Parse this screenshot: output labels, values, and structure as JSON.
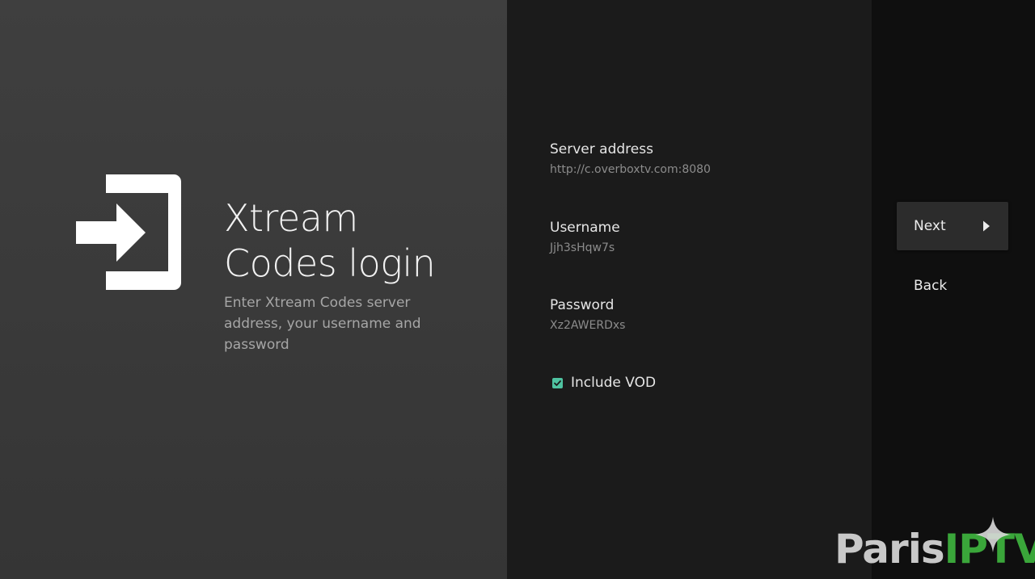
{
  "guidance": {
    "icon": "login-icon",
    "title_line1": "Xtream",
    "title_line2": "Codes login",
    "description": "Enter Xtream Codes server address, your username and password"
  },
  "form": {
    "server": {
      "label": "Server address",
      "value": "http://c.overboxtv.com:8080"
    },
    "username": {
      "label": "Username",
      "value": "Jjh3sHqw7s"
    },
    "password": {
      "label": "Password",
      "value": "Xz2AWERDxs"
    },
    "include_vod": {
      "label": "Include VOD",
      "checked": true
    }
  },
  "actions": {
    "next_label": "Next",
    "next_icon": "play-arrow-icon",
    "back_label": "Back"
  },
  "watermark": {
    "part1": "Paris",
    "part2": "IPTV"
  },
  "colors": {
    "accent_checkbox": "#4fc3a1",
    "watermark_green": "#3aa63a"
  }
}
